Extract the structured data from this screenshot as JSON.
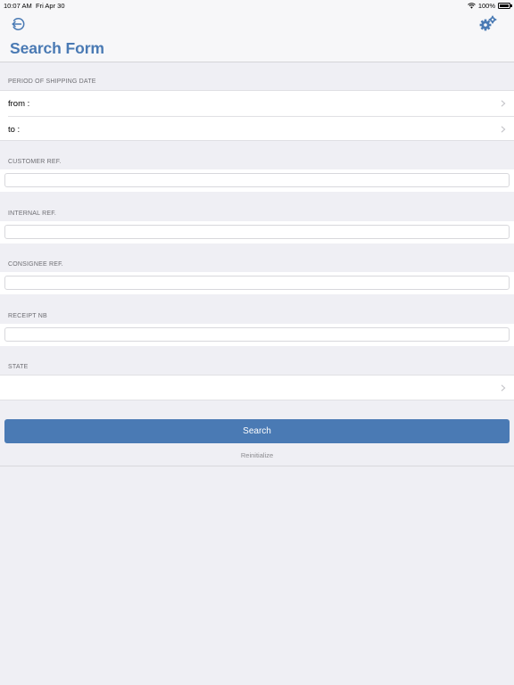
{
  "status_bar": {
    "time": "10:07 AM",
    "date": "Fri Apr 30",
    "battery_text": "100%",
    "battery_level": 1.0,
    "icons": [
      "wifi-icon",
      "battery-icon"
    ]
  },
  "nav": {
    "back_icon": "back-arrow-circle-icon",
    "settings_icon": "gears-icon",
    "title": "Search Form"
  },
  "shipping": {
    "header": "PERIOD OF SHIPPING DATE",
    "from_label": "from :",
    "to_label": "to :"
  },
  "customer_ref": {
    "header": "CUSTOMER REF.",
    "value": "",
    "placeholder": ""
  },
  "internal_ref": {
    "header": "INTERNAL REF.",
    "value": "",
    "placeholder": ""
  },
  "consignee_ref": {
    "header": "CONSIGNEE REF.",
    "value": "",
    "placeholder": ""
  },
  "receipt_nb": {
    "header": "RECEIPT NB",
    "value": "",
    "placeholder": ""
  },
  "state": {
    "header": "STATE",
    "value": ""
  },
  "actions": {
    "search_label": "Search",
    "reinitialize_label": "Reinitialize"
  },
  "colors": {
    "accent": "#4a7ab4",
    "background": "#efeff4",
    "secondary_text": "#6d6d72"
  }
}
